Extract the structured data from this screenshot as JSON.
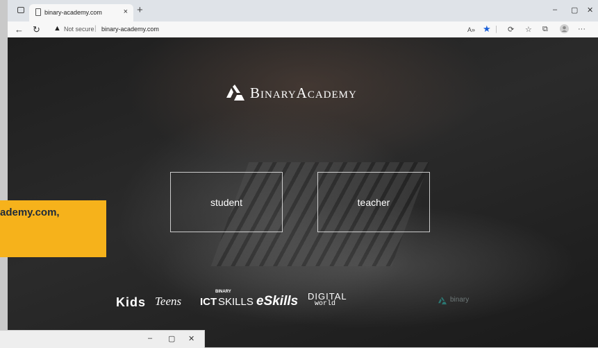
{
  "browser": {
    "tab_title": "binary-academy.com",
    "tab_close": "×",
    "new_tab": "+",
    "window_controls": {
      "minimize": "–",
      "maximize": "▢",
      "close": "✕"
    },
    "nav": {
      "back": "←",
      "refresh": "↻"
    },
    "security_label": "Not secure",
    "separator": "|",
    "url": "binary-academy.com",
    "toolbar_icons": [
      "read-aloud-icon",
      "favorite-star-icon",
      "collections-icon",
      "favorites-icon",
      "extensions-icon",
      "profile-icon",
      "more-icon"
    ],
    "more": "···",
    "read_aloud": "A»"
  },
  "page": {
    "brand": "BinaryAcademy",
    "buttons": {
      "student": "student",
      "teacher": "teacher"
    },
    "brands": {
      "kids": "Kids",
      "teens": "Teens",
      "ict_small": "BINARY",
      "ict_bold": "ICT",
      "ict_rest": "SKILLS",
      "eskills": "eSkills",
      "digital": "DIGITAL",
      "world": "world",
      "footer_brand": "binary"
    }
  },
  "overlay": {
    "tooltip_text": "ademy.com,"
  },
  "second_window": {
    "controls": {
      "minimize": "–",
      "maximize": "▢",
      "close": "✕"
    }
  },
  "colors": {
    "tooltip": "#f6b21b",
    "star": "#1a5fd8",
    "brand_teal": "#2ba7a0"
  }
}
